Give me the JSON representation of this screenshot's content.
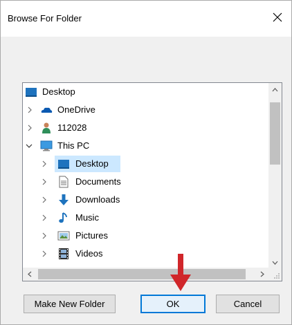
{
  "window": {
    "title": "Browse For Folder"
  },
  "tree": {
    "items": [
      {
        "label": "Desktop",
        "icon": "desktop-icon",
        "expander": "none"
      },
      {
        "label": "OneDrive",
        "icon": "cloud-icon",
        "expander": "collapsed"
      },
      {
        "label": "112028",
        "icon": "user-icon",
        "expander": "collapsed"
      },
      {
        "label": "This PC",
        "icon": "computer-icon",
        "expander": "expanded"
      },
      {
        "label": "Desktop",
        "icon": "desktop-icon",
        "expander": "collapsed",
        "selected": true
      },
      {
        "label": "Documents",
        "icon": "documents-icon",
        "expander": "collapsed"
      },
      {
        "label": "Downloads",
        "icon": "download-arrow-icon",
        "expander": "collapsed"
      },
      {
        "label": "Music",
        "icon": "music-note-icon",
        "expander": "collapsed"
      },
      {
        "label": "Pictures",
        "icon": "pictures-icon",
        "expander": "collapsed"
      },
      {
        "label": "Videos",
        "icon": "videos-icon",
        "expander": "collapsed"
      }
    ]
  },
  "buttons": {
    "make_new_folder": "Make New Folder",
    "ok": "OK",
    "cancel": "Cancel"
  },
  "colors": {
    "selection": "#cce8ff",
    "accent": "#0078d7",
    "annotation_arrow": "#d0262a"
  }
}
